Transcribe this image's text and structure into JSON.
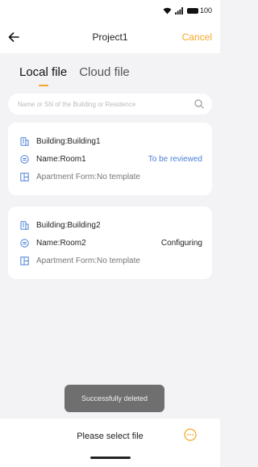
{
  "status_bar": {
    "battery": "100"
  },
  "header": {
    "title": "Project1",
    "cancel_label": "Cancel"
  },
  "tabs": [
    {
      "label": "Local file"
    },
    {
      "label": "Cloud file"
    }
  ],
  "search": {
    "placeholder": "Name or SN of the Building or Residence"
  },
  "cards": [
    {
      "building": "Building:Building1",
      "name": "Name:Room1",
      "form": "Apartment Form:No template",
      "status": "To be reviewed"
    },
    {
      "building": "Building:Building2",
      "name": "Name:Room2",
      "form": "Apartment Form:No template",
      "status": "Configuring"
    }
  ],
  "toast": {
    "message": "Successfully deleted"
  },
  "footer": {
    "text": "Please select file"
  },
  "colors": {
    "accent": "#f5a623",
    "review": "#4a7fd6"
  }
}
